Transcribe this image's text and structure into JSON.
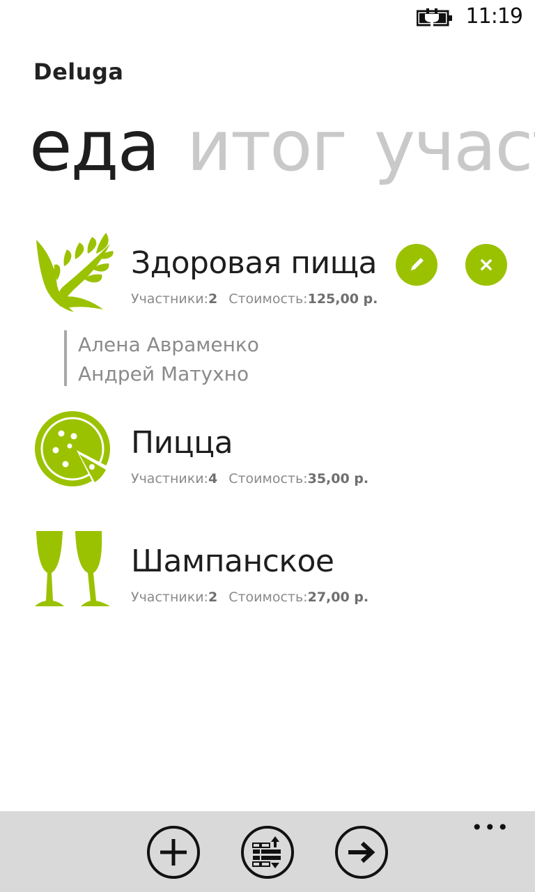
{
  "status_bar": {
    "time": "11:19",
    "battery_icon": "battery-charging-icon"
  },
  "app": {
    "title": "Deluga"
  },
  "pivot": {
    "tabs": [
      {
        "label": "еда",
        "active": true
      },
      {
        "label": "итог",
        "active": false
      },
      {
        "label": "участ",
        "active": false
      }
    ]
  },
  "labels": {
    "participants": "Участники:",
    "cost": "Стоимость:"
  },
  "items": [
    {
      "name": "Здоровая пища",
      "icon": "wheat-icon",
      "participants_count": "2",
      "cost": "125,00 р.",
      "expanded": true,
      "members": [
        "Алена Авраменко",
        "Андрей Матухно"
      ]
    },
    {
      "name": "Пицца",
      "icon": "pizza-icon",
      "participants_count": "4",
      "cost": "35,00 р.",
      "expanded": false
    },
    {
      "name": "Шампанское",
      "icon": "champagne-glasses-icon",
      "participants_count": "2",
      "cost": "27,00 р.",
      "expanded": false
    }
  ],
  "app_bar": {
    "buttons": [
      "add-icon",
      "reorder-icon",
      "next-arrow-icon"
    ],
    "more": "•••"
  },
  "colors": {
    "accent": "#9bc200",
    "text": "#1e1e1e",
    "muted": "#8a8a8a",
    "app_bar": "#d9d9d9"
  }
}
